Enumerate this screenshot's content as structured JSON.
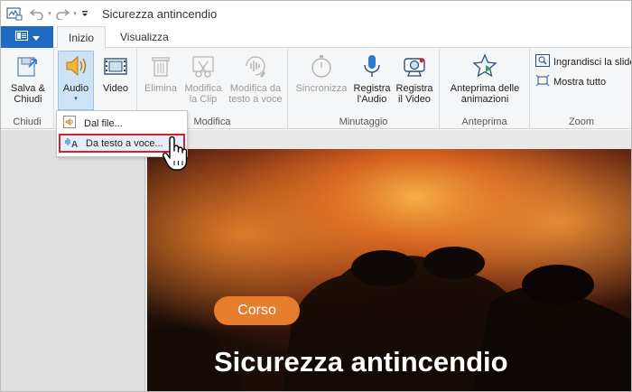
{
  "window": {
    "title": "Sicurezza antincendio"
  },
  "tabs": [
    {
      "label": "Inizio",
      "active": true
    },
    {
      "label": "Visualizza",
      "active": false
    }
  ],
  "ribbon": {
    "groups": [
      {
        "label": "Chiudi",
        "buttons": [
          {
            "label": "Salva &\nChiudi",
            "icon": "save-close-icon"
          }
        ]
      },
      {
        "label": "",
        "buttons": [
          {
            "label": "Audio",
            "icon": "speaker-icon",
            "selected": true
          },
          {
            "label": "Video",
            "icon": "film-icon"
          }
        ]
      },
      {
        "label": "Modifica",
        "buttons": [
          {
            "label": "Elimina",
            "icon": "trash-icon",
            "disabled": true
          },
          {
            "label": "Modifica\nla Clip",
            "icon": "scissors-icon",
            "disabled": true
          },
          {
            "label": "Modifica da\ntesto a voce",
            "icon": "text-to-speech-icon",
            "disabled": true
          }
        ]
      },
      {
        "label": "Minutaggio",
        "buttons": [
          {
            "label": "Sincronizza",
            "icon": "stopwatch-icon",
            "disabled": true
          },
          {
            "label": "Registra\nl'Audio",
            "icon": "microphone-icon"
          },
          {
            "label": "Registra\nil Video",
            "icon": "webcam-icon"
          }
        ]
      },
      {
        "label": "Anteprima",
        "buttons": [
          {
            "label": "Anteprima delle\nanimazioni",
            "icon": "star-preview-icon"
          }
        ]
      },
      {
        "label": "Zoom",
        "buttons": [
          {
            "label": "Ingrandisci la slide",
            "icon": "zoom-slide-icon"
          },
          {
            "label": "Mostra tutto",
            "icon": "show-all-icon"
          }
        ]
      }
    ]
  },
  "audio_menu": {
    "items": [
      {
        "label": "Dal file...",
        "icon": "audio-file-icon"
      },
      {
        "label": "Da testo a voce...",
        "icon": "text-to-speech-icon",
        "highlighted": true
      }
    ]
  },
  "slide": {
    "badge": "Corso",
    "title": "Sicurezza antincendio"
  },
  "colors": {
    "accent": "#1f6bc3",
    "badge": "#e67e2e",
    "highlight_border": "#d8202a"
  }
}
